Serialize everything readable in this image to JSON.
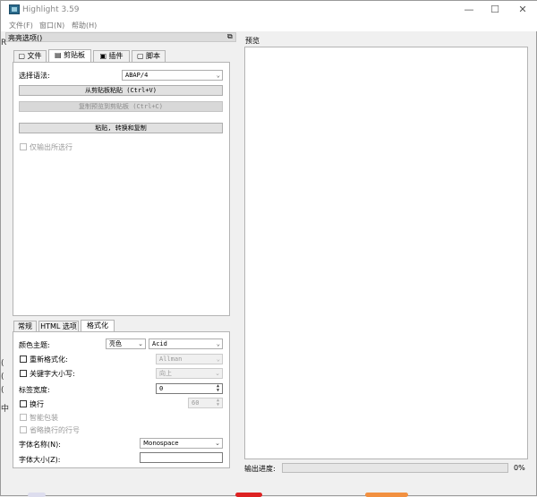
{
  "window": {
    "title": "Highlight 3.59",
    "minimize": "—",
    "maximize": "☐",
    "close": "✕"
  },
  "menu": [
    "文件(F)",
    "窗口(N)",
    "帮助(H)"
  ],
  "left_panel": {
    "header": "亮亮选项()",
    "restore_icon": "⧉"
  },
  "top_tabs": [
    "文件",
    "剪贴板",
    "插件",
    "脚本"
  ],
  "clipboard": {
    "syntax_label": "选择语法:",
    "syntax_value": "ABAP/4",
    "paste_button": "从剪贴板粘贴 (Ctrl+V)",
    "copy_button": "复制预览到剪贴板 (Ctrl+C)",
    "paste_convert_button": "粘贴, 转换和复制",
    "selected_lines_only": "仅输出所选行"
  },
  "bottom_tabs": [
    "常规",
    "HTML 选项",
    "格式化"
  ],
  "formatting": {
    "theme_label": "颜色主题:",
    "theme_brightness": "亮色",
    "theme_name": "Acid",
    "reformat_label": "重新格式化:",
    "reformat_value": "Allman",
    "keyword_case_label": "关键字大小写:",
    "keyword_case_value": "向上",
    "tab_width_label": "标签宽度:",
    "tab_width_value": "0",
    "wrap_label": "换行",
    "wrap_value": "60",
    "smart_wrap_label": "智能包装",
    "omit_line_numbers_label": "省略换行的行号",
    "font_name_label": "字体名称(N):",
    "font_name_value": "Monospace",
    "font_size_label": "字体大小(Z):",
    "font_size_value": ""
  },
  "preview": {
    "label": "预览"
  },
  "status": {
    "progress_label": "输出进度:",
    "progress_value": "0%",
    "progress_fraction": 0
  },
  "background": {
    "left_chars": [
      "R",
      "(",
      "(",
      "(",
      "中"
    ]
  }
}
